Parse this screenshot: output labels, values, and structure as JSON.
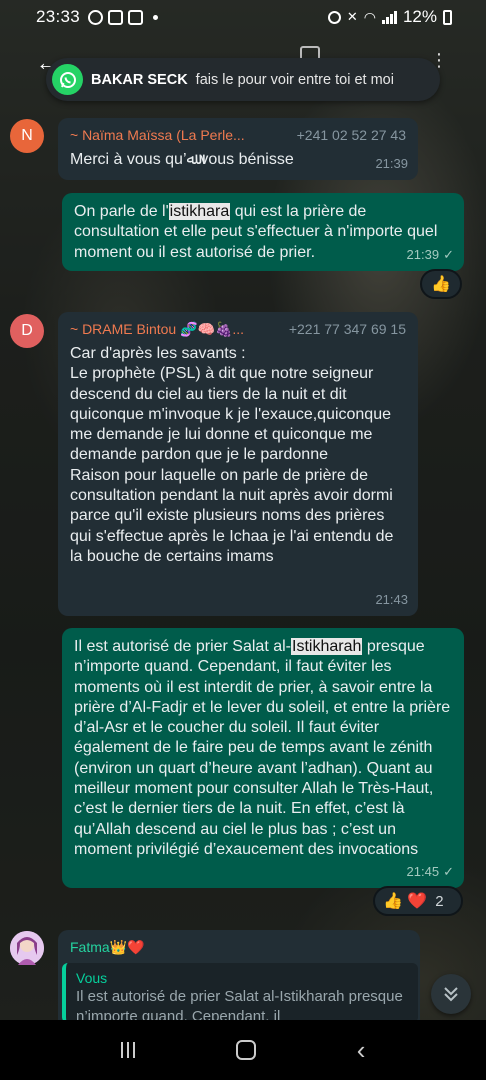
{
  "status_bar": {
    "time": "23:33",
    "battery": "12%"
  },
  "notification": {
    "sender": "BAKAR SECK",
    "text": "fais le pour voir entre toi et moi"
  },
  "messages": [
    {
      "avatar_letter": "N",
      "avatar_color": "#e8663a",
      "sender": "~ Naïma Maïssa (La Perle...",
      "phone": "+241 02 52 27 43",
      "text": "Merci à vous qu’ﷲ vous bénisse",
      "time": "21:39"
    },
    {
      "text_before": "On parle de l'",
      "highlight": "istikhara",
      "text_after": " qui est la prière de consultation et elle peut s'effectuer à n'importe quel moment ou il est autorisé de prier.",
      "time": "21:39",
      "reaction": "👍"
    },
    {
      "avatar_letter": "D",
      "avatar_color": "#e0605f",
      "sender": "~ DRAME Bintou 🧬🧠🍇...",
      "phone": "+221 77 347 69 15",
      "text": "Car d'après les savants :\nLe prophète (PSL) à dit que notre seigneur descend du ciel au tiers de la nuit et dit quiconque m'invoque k je l'exauce,quiconque me demande je lui donne et quiconque me demande pardon que je le pardonne\nRaison pour laquelle on parle de prière de consultation pendant la nuit après avoir dormi parce qu'il existe plusieurs noms des prières qui s'effectue après le Ichaa je l'ai entendu de la bouche de certains imams",
      "time": "21:43"
    },
    {
      "text_before": "Il est autorisé de prier Salat al-",
      "highlight": "Istikharah",
      "text_after": " presque n’importe quand. Cependant, il faut éviter les moments où il est interdit de prier, à savoir entre la prière d’Al-Fadjr et le lever du soleil, et entre la prière d’al-Asr et le coucher du soleil. Il faut éviter également de le faire peu de temps avant le zénith (environ un quart d’heure avant l’adhan). Quant au meilleur moment pour consulter Allah le Très-Haut, c’est le dernier tiers de la nuit. En effet, c’est là qu’Allah descend au ciel le plus bas ; c’est un moment privilégié d’exaucement des invocations",
      "time": "21:45",
      "reactions": "👍 ❤️",
      "reaction_count": "2"
    },
    {
      "sender": "Fatma👑❤️",
      "quote_author": "Vous",
      "quote_text": "Il est autorisé de prier Salat al-Istikharah presque n’importe quand. Cependant, il"
    }
  ],
  "icons": {
    "back": "back-arrow-icon",
    "scroll_down": "double-chevron-down-icon",
    "read_receipt": "check-icon"
  },
  "colors": {
    "incoming_bubble": "#222e35",
    "outgoing_bubble": "#005c4b",
    "accent": "#06cf9c",
    "whatsapp_green": "#25d366"
  }
}
